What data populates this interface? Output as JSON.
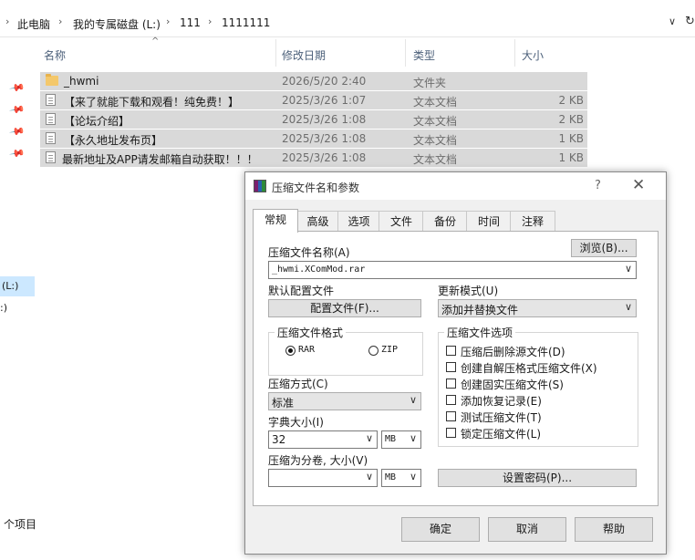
{
  "explorer": {
    "breadcrumb": [
      "此电脑",
      "我的专属磁盘 (L:)",
      "111",
      "1111111"
    ],
    "columns": {
      "name": "名称",
      "date": "修改日期",
      "type": "类型",
      "size": "大小"
    },
    "files": [
      {
        "name": "_hwmi",
        "date": "2026/5/20 2:40",
        "type": "文件夹",
        "size": "",
        "icon": "folder-icon"
      },
      {
        "name": "【来了就能下载和观看！纯免费！】",
        "date": "2025/3/26 1:07",
        "type": "文本文档",
        "size": "2 KB",
        "icon": "text-file-icon"
      },
      {
        "name": "【论坛介绍】",
        "date": "2025/3/26 1:08",
        "type": "文本文档",
        "size": "2 KB",
        "icon": "text-file-icon"
      },
      {
        "name": "【永久地址发布页】",
        "date": "2025/3/26 1:08",
        "type": "文本文档",
        "size": "1 KB",
        "icon": "text-file-icon"
      },
      {
        "name": "最新地址及APP请发邮箱自动获取！！！",
        "date": "2025/3/26 1:08",
        "type": "文本文档",
        "size": "1 KB",
        "icon": "text-file-icon"
      }
    ],
    "sidebar_drive": "(L:)",
    "sidebar_drive2": ":)",
    "item_count": "个项目"
  },
  "dialog": {
    "title": "压缩文件名和参数",
    "help": "?",
    "close": "✕",
    "tabs": [
      "常规",
      "高级",
      "选项",
      "文件",
      "备份",
      "时间",
      "注释"
    ],
    "archive_name_label": "压缩文件名称(A)",
    "browse_button": "浏览(B)...",
    "archive_name_value": "_hwmi.XComMod.rar",
    "default_profile_label": "默认配置文件",
    "profile_button": "配置文件(F)...",
    "update_mode_label": "更新模式(U)",
    "update_mode_value": "添加并替换文件",
    "format_group": "压缩文件格式",
    "format_rar": "RAR",
    "format_zip": "ZIP",
    "options_group": "压缩文件选项",
    "options": [
      "压缩后删除源文件(D)",
      "创建自解压格式压缩文件(X)",
      "创建固实压缩文件(S)",
      "添加恢复记录(E)",
      "测试压缩文件(T)",
      "锁定压缩文件(L)"
    ],
    "method_label": "压缩方式(C)",
    "method_value": "标准",
    "dict_label": "字典大小(I)",
    "dict_value": "32",
    "dict_unit": "MB",
    "split_label": "压缩为分卷, 大小(V)",
    "split_value": "",
    "split_unit": "MB",
    "password_button": "设置密码(P)...",
    "ok_button": "确定",
    "cancel_button": "取消",
    "help_button": "帮助"
  }
}
